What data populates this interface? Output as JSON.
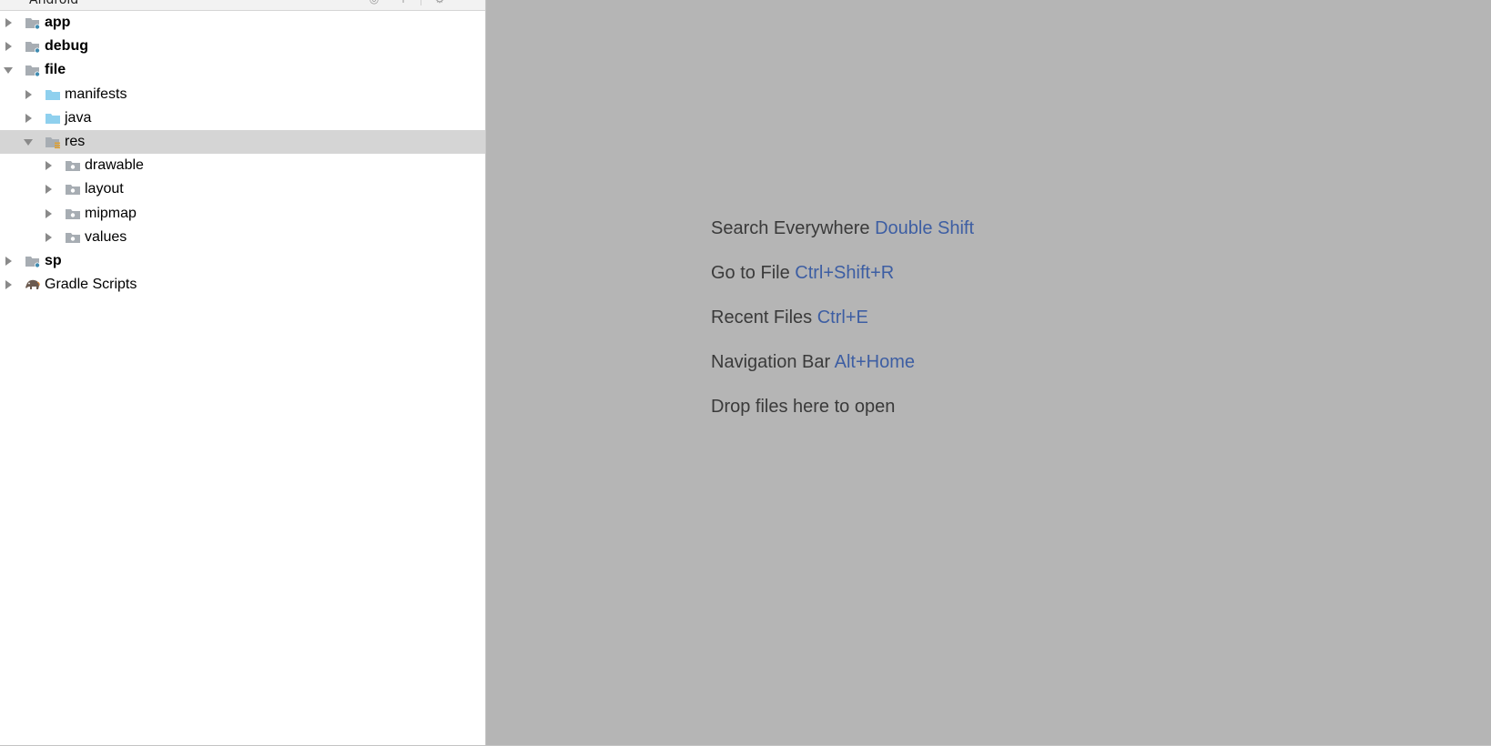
{
  "panel_header": {
    "view_label": "Android"
  },
  "tree": [
    {
      "label": "app",
      "bold": true,
      "expanded": false,
      "depth": 0,
      "icon": "module-folder-icon"
    },
    {
      "label": "debug",
      "bold": true,
      "expanded": false,
      "depth": 0,
      "icon": "module-folder-icon"
    },
    {
      "label": "file",
      "bold": true,
      "expanded": true,
      "depth": 0,
      "icon": "module-folder-icon"
    },
    {
      "label": "manifests",
      "bold": false,
      "expanded": false,
      "depth": 1,
      "icon": "source-folder-icon"
    },
    {
      "label": "java",
      "bold": false,
      "expanded": false,
      "depth": 1,
      "icon": "source-folder-icon"
    },
    {
      "label": "res",
      "bold": false,
      "expanded": true,
      "depth": 1,
      "icon": "resource-folder-icon",
      "selected": true
    },
    {
      "label": "drawable",
      "bold": false,
      "expanded": false,
      "depth": 2,
      "icon": "package-folder-icon"
    },
    {
      "label": "layout",
      "bold": false,
      "expanded": false,
      "depth": 2,
      "icon": "package-folder-icon"
    },
    {
      "label": "mipmap",
      "bold": false,
      "expanded": false,
      "depth": 2,
      "icon": "package-folder-icon"
    },
    {
      "label": "values",
      "bold": false,
      "expanded": false,
      "depth": 2,
      "icon": "package-folder-icon"
    },
    {
      "label": "sp",
      "bold": true,
      "expanded": false,
      "depth": 0,
      "icon": "module-folder-icon"
    },
    {
      "label": "Gradle Scripts",
      "bold": false,
      "expanded": false,
      "depth": 0,
      "icon": "gradle-elephant-icon"
    }
  ],
  "editor": {
    "hints": [
      {
        "text": "Search Everywhere",
        "shortcut": "Double Shift"
      },
      {
        "text": "Go to File",
        "shortcut": "Ctrl+Shift+R"
      },
      {
        "text": "Recent Files",
        "shortcut": "Ctrl+E"
      },
      {
        "text": "Navigation Bar",
        "shortcut": "Alt+Home"
      },
      {
        "text": "Drop files here to open",
        "shortcut": ""
      }
    ]
  },
  "colors": {
    "editor_bg": "#b5b5b5",
    "shortcut_text": "#3d5ea3",
    "hint_text": "#3a3a3a",
    "selected_row": "#d5d5d5",
    "source_folder": "#8fd0ee",
    "module_dot": "#3f8bb0"
  }
}
